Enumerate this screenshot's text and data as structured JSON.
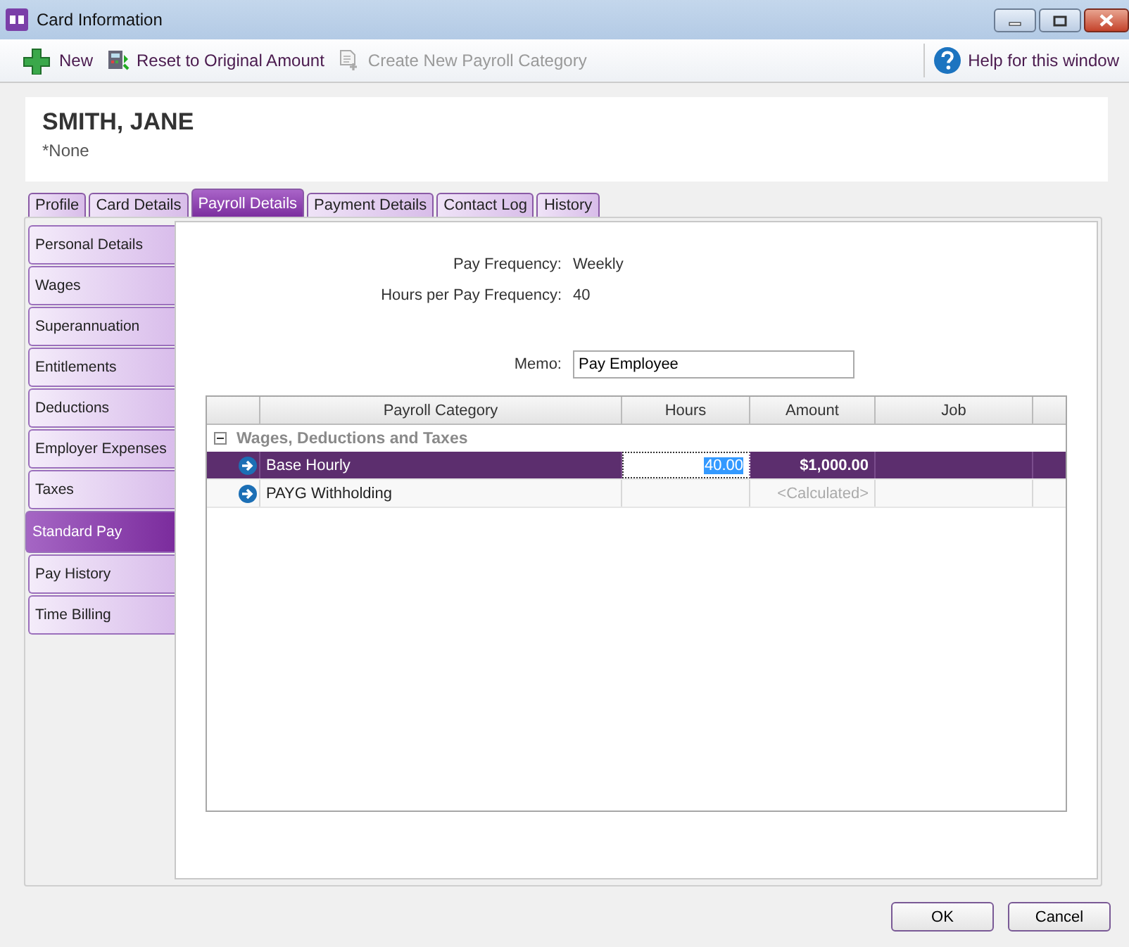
{
  "window": {
    "title": "Card Information"
  },
  "toolbar": {
    "items": [
      {
        "kind": "new",
        "label": "New",
        "disabled": false
      },
      {
        "kind": "reset",
        "label": "Reset to Original Amount",
        "disabled": false
      },
      {
        "kind": "create",
        "label": "Create New Payroll Category",
        "disabled": true
      }
    ],
    "help": "Help for this window"
  },
  "header": {
    "name": "SMITH, JANE",
    "subtitle": "*None"
  },
  "tabs": [
    {
      "label": "Profile",
      "selected": false
    },
    {
      "label": "Card Details",
      "selected": false
    },
    {
      "label": "Payroll Details",
      "selected": true
    },
    {
      "label": "Payment Details",
      "selected": false
    },
    {
      "label": "Contact Log",
      "selected": false
    },
    {
      "label": "History",
      "selected": false
    }
  ],
  "sidebar": {
    "items": [
      {
        "label": "Personal Details",
        "selected": false
      },
      {
        "label": "Wages",
        "selected": false
      },
      {
        "label": "Superannuation",
        "selected": false
      },
      {
        "label": "Entitlements",
        "selected": false
      },
      {
        "label": "Deductions",
        "selected": false
      },
      {
        "label": "Employer Expenses",
        "selected": false
      },
      {
        "label": "Taxes",
        "selected": false
      },
      {
        "label": "Standard Pay",
        "selected": true
      },
      {
        "label": "Pay History",
        "selected": false
      },
      {
        "label": "Time Billing",
        "selected": false
      }
    ]
  },
  "fields": [
    {
      "label": "Pay Frequency:",
      "value": "Weekly"
    },
    {
      "label": "Hours per Pay Frequency:",
      "value": "40"
    }
  ],
  "memo": {
    "label": "Memo:",
    "value": "Pay Employee"
  },
  "table": {
    "columns": [
      "Payroll Category",
      "Hours",
      "Amount",
      "Job"
    ],
    "group": {
      "label": "Wages, Deductions and Taxes",
      "expanded": true
    },
    "rows": [
      {
        "category": "Base Hourly",
        "hours": "40.00",
        "amount": "$1,000.00",
        "selected": true
      },
      {
        "category": "PAYG Withholding",
        "amount": "<Calculated>",
        "selected": false
      }
    ]
  },
  "buttons": [
    "OK",
    "Cancel"
  ]
}
